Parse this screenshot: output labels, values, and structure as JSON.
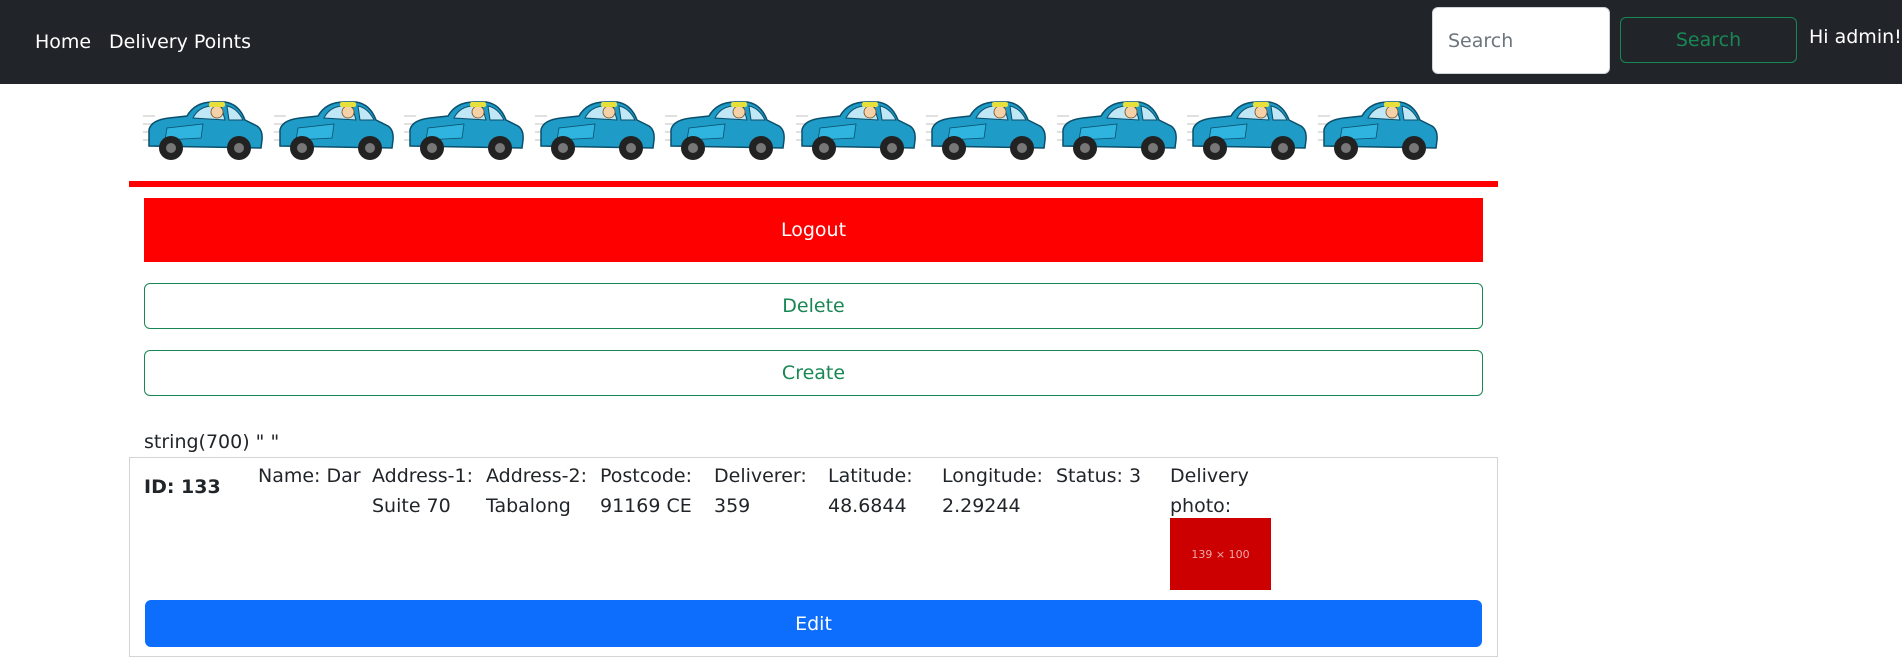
{
  "navbar": {
    "home_label": "Home",
    "delivery_points_label": "Delivery Points",
    "search_placeholder": "Search",
    "search_button_label": "Search",
    "greeting": "Hi admin!"
  },
  "banner": {
    "car_count": 10,
    "car_icon": "delivery-car-icon",
    "rule_color": "#ff0000"
  },
  "actions": {
    "logout_label": "Logout",
    "delete_label": "Delete",
    "create_label": "Create"
  },
  "debug_output": "string(700) \" \"",
  "record": {
    "id": "ID: 133",
    "name": "Name: Dar",
    "address1": "Address-1: Suite 70",
    "address2": "Address-2: Tabalong",
    "postcode": "Postcode: 91169 CE",
    "deliverer": "Deliverer: 359",
    "latitude": "Latitude: 48.6844",
    "longitude": "Longitude: 2.29244",
    "status": "Status: 3",
    "photo_label": "Delivery photo:",
    "photo_placeholder": "139 × 100",
    "edit_label": "Edit"
  },
  "colors": {
    "navbar_bg": "#212529",
    "logout_bg": "#ff0000",
    "outline_green": "#198754",
    "edit_blue": "#0d6efd",
    "photo_red": "#cc0000"
  }
}
